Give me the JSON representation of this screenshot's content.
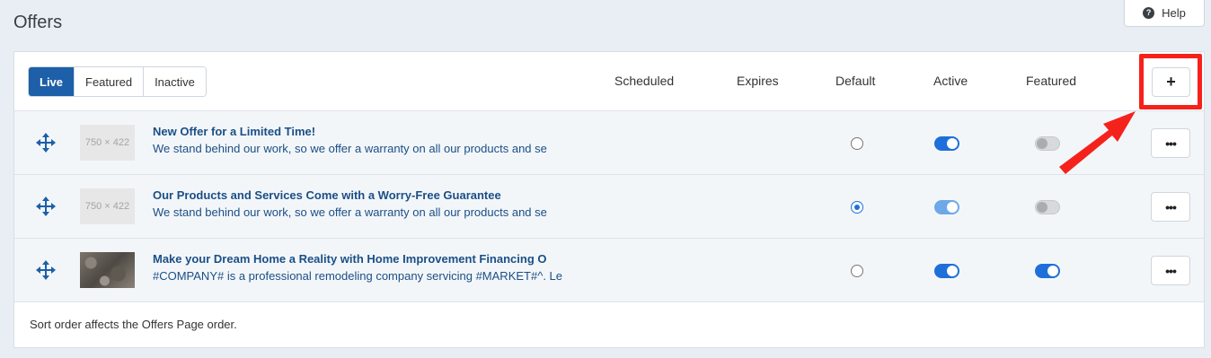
{
  "page": {
    "title": "Offers"
  },
  "help": {
    "label": "Help",
    "icon": "question-circle-icon"
  },
  "tabs": [
    {
      "label": "Live",
      "active": true
    },
    {
      "label": "Featured",
      "active": false
    },
    {
      "label": "Inactive",
      "active": false
    }
  ],
  "columns": {
    "scheduled": "Scheduled",
    "expires": "Expires",
    "default": "Default",
    "active": "Active",
    "featured": "Featured"
  },
  "add_button": {
    "label": "+"
  },
  "offers": [
    {
      "thumb": "750 × 422",
      "title": "New Offer for a Limited Time!",
      "description": "We stand behind our work, so we offer a warranty on all our products and se",
      "default": false,
      "active": true,
      "featured": false
    },
    {
      "thumb": "750 × 422",
      "title": "Our Products and Services Come with a Worry-Free Guarantee",
      "description": "We stand behind our work, so we offer a warranty on all our products and se",
      "default": true,
      "active": true,
      "featured": false
    },
    {
      "thumb": "",
      "title": "Make your Dream Home a Reality with Home Improvement Financing O",
      "description": "#COMPANY# is a professional remodeling company servicing #MARKET#^. Le",
      "default": false,
      "active": true,
      "featured": true
    }
  ],
  "more_button": {
    "label": "•••"
  },
  "footer": {
    "note": "Sort order affects the Offers Page order."
  },
  "colors": {
    "accent": "#1d5fa8",
    "toggle_on": "#1e6fd9",
    "highlight": "#f5221b"
  }
}
